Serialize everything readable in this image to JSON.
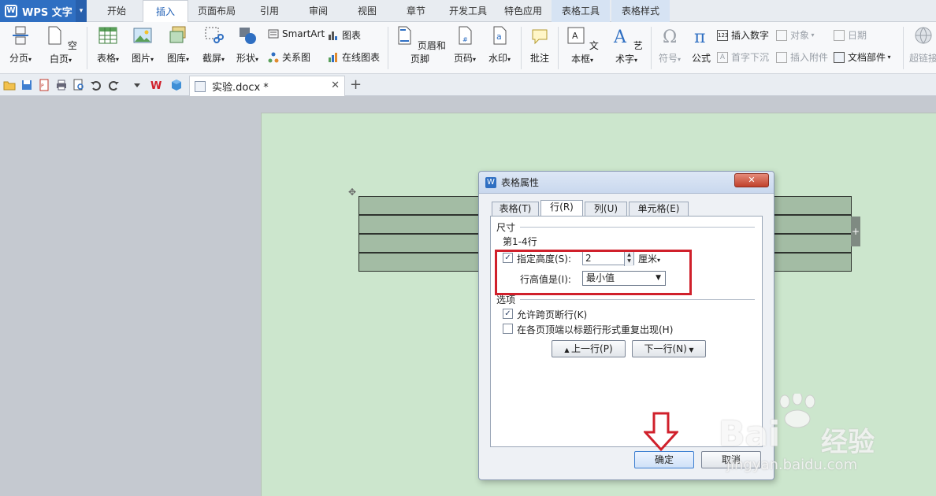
{
  "app": {
    "title": "WPS 文字"
  },
  "menu_tabs": [
    "开始",
    "插入",
    "页面布局",
    "引用",
    "审阅",
    "视图",
    "章节",
    "开发工具",
    "特色应用",
    "表格工具",
    "表格样式"
  ],
  "ribbon": {
    "page_break": "分页",
    "blank_page": "空白页",
    "table": "表格",
    "picture": "图片",
    "gallery": "图库",
    "screenshot": "截屏",
    "shapes": "形状",
    "smartart": "SmartArt",
    "chart": "图表",
    "relation": "关系图",
    "online_chart": "在线图表",
    "header_footer": "页眉和页脚",
    "page_number": "页码",
    "watermark": "水印",
    "comment": "批注",
    "textbox": "文本框",
    "wordart": "艺术字",
    "symbol": "符号",
    "formula": "公式",
    "insert_number": "插入数字",
    "dropcap": "首字下沉",
    "object": "对象",
    "attachment": "插入附件",
    "date": "日期",
    "doc_parts": "文档部件",
    "hyperlink": "超链接"
  },
  "document_tab": {
    "name": "实验.docx *"
  },
  "dialog": {
    "title": "表格属性",
    "close": "✕",
    "tabs": [
      "表格(T)",
      "行(R)",
      "列(U)",
      "单元格(E)"
    ],
    "section_size": "尺寸",
    "rows_label": "第1-4行",
    "specify_height_label": "指定高度(S):",
    "specify_height_checked": true,
    "height_value": "2",
    "height_unit": "厘米",
    "row_height_is_label": "行高值是(I):",
    "row_height_is_value": "最小值",
    "section_options": "选项",
    "allow_break_label": "允许跨页断行(K)",
    "allow_break_checked": true,
    "repeat_header_label": "在各页顶端以标题行形式重复出现(H)",
    "repeat_header_checked": false,
    "prev_row": "上一行(P)",
    "next_row": "下一行(N)",
    "ok": "确定",
    "cancel": "取消"
  },
  "watermark": {
    "brand": "Bai",
    "brand2": "经验",
    "url": "jingyan.baidu.com"
  },
  "colors": {
    "accent": "#2f6fc2",
    "page_bg": "#cce6cd",
    "table_fill": "#a3bca4",
    "highlight": "#d0202b"
  }
}
